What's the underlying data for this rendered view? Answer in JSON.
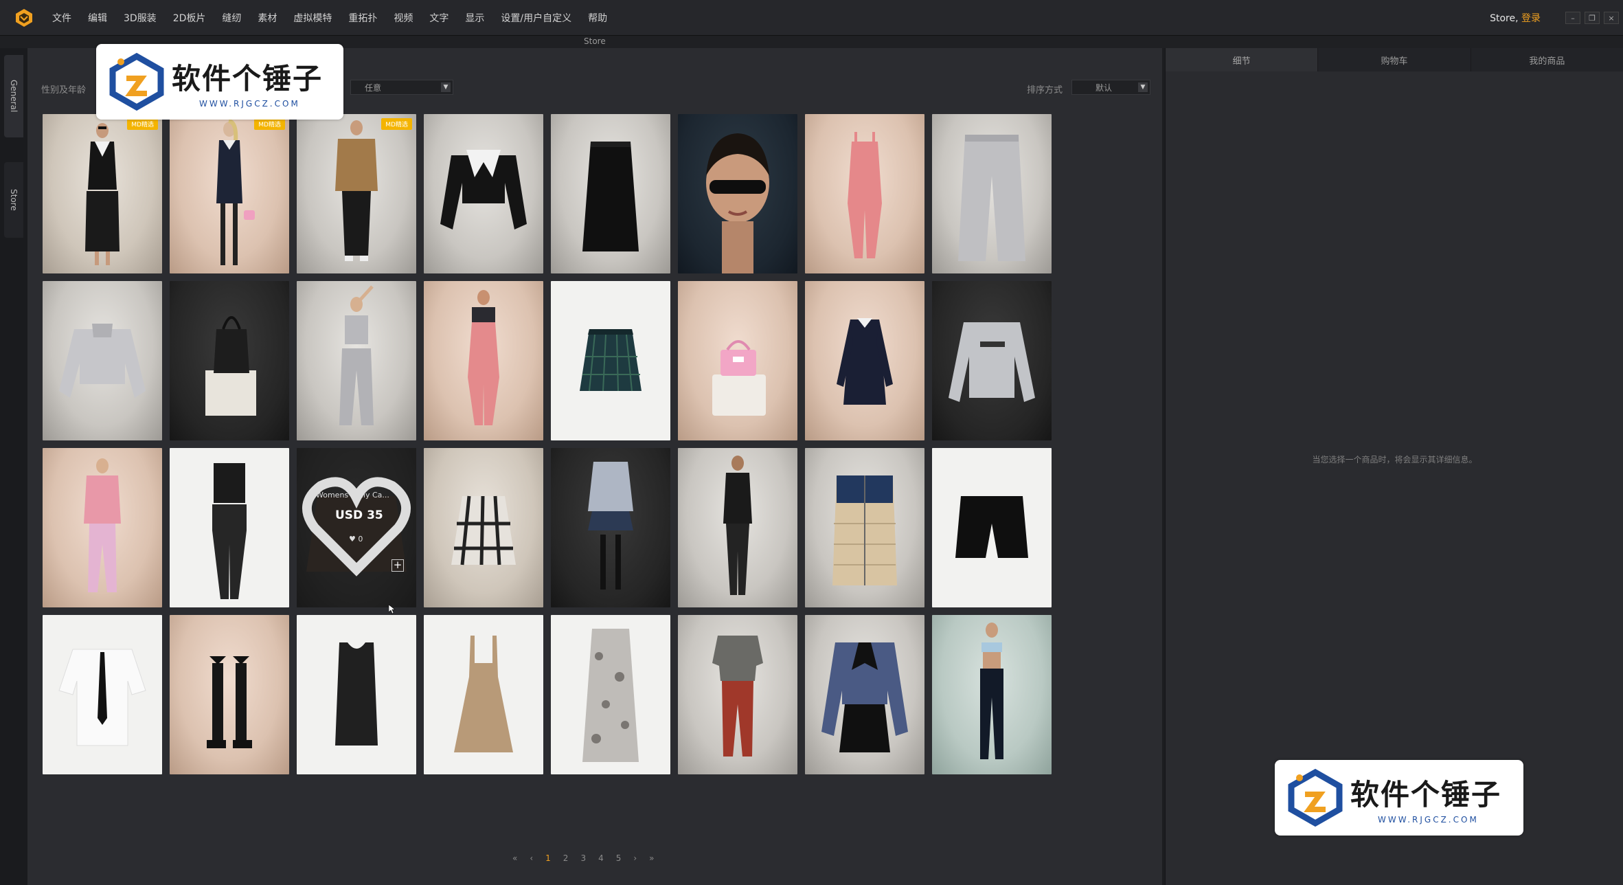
{
  "menubar": {
    "items": [
      "文件",
      "编辑",
      "3D服装",
      "2D板片",
      "缝纫",
      "素材",
      "虚拟模特",
      "重拓扑",
      "视频",
      "文字",
      "显示",
      "设置/用户自定义",
      "帮助"
    ],
    "store_user": "Store,",
    "login": "登录"
  },
  "store_strip": {
    "label": "Store"
  },
  "side_tabs": {
    "general": "General",
    "store": "Store"
  },
  "filters": {
    "gender_label": "性别及年龄",
    "gender_value": "任意",
    "sort_label": "排序方式",
    "sort_value": "默认"
  },
  "grid": {
    "badge_text": "MD精选",
    "items": [
      {
        "bg": "studio",
        "kind": "model-dark-outfit",
        "badge": true
      },
      {
        "bg": "pink",
        "kind": "model-navy-dress",
        "badge": true
      },
      {
        "bg": "grey",
        "kind": "model-brown-sweater",
        "badge": true
      },
      {
        "bg": "grey",
        "kind": "crop-jacket-black",
        "badge": false
      },
      {
        "bg": "grey",
        "kind": "skirt-black",
        "badge": false
      },
      {
        "bg": "navy",
        "kind": "avatar-head",
        "badge": false
      },
      {
        "bg": "pink",
        "kind": "pink-jumpsuit",
        "badge": false
      },
      {
        "bg": "grey",
        "kind": "grey-pants",
        "badge": false
      },
      {
        "bg": "grey",
        "kind": "grey-crop-sweatshirt",
        "badge": false
      },
      {
        "bg": "dark",
        "kind": "black-bag",
        "badge": false
      },
      {
        "bg": "grey",
        "kind": "model-grey-set",
        "badge": false
      },
      {
        "bg": "pink",
        "kind": "model-pink-overall",
        "badge": false
      },
      {
        "bg": "white",
        "kind": "plaid-skirt-green",
        "badge": false
      },
      {
        "bg": "pink",
        "kind": "pink-bag",
        "badge": false
      },
      {
        "bg": "pink",
        "kind": "navy-dress",
        "badge": false
      },
      {
        "bg": "dark",
        "kind": "grey-sweatshirt-logo",
        "badge": false
      },
      {
        "bg": "pink",
        "kind": "model-pink-sweater",
        "badge": false
      },
      {
        "bg": "white",
        "kind": "black-corset-pants",
        "badge": false
      },
      {
        "bg": "dark",
        "kind": "hover-cardigan",
        "badge": false
      },
      {
        "bg": "studio",
        "kind": "plaid-skirt-bw",
        "badge": false
      },
      {
        "bg": "dark",
        "kind": "uniform-set",
        "badge": false
      },
      {
        "bg": "grey",
        "kind": "model-black-leather",
        "badge": false
      },
      {
        "bg": "grey",
        "kind": "puffer-vest",
        "badge": false
      },
      {
        "bg": "white",
        "kind": "black-shorts",
        "badge": false
      },
      {
        "bg": "white",
        "kind": "white-shirt-tie",
        "badge": false
      },
      {
        "bg": "pink",
        "kind": "black-boots",
        "badge": false
      },
      {
        "bg": "white",
        "kind": "black-tank",
        "badge": false
      },
      {
        "bg": "white",
        "kind": "beige-pinafore",
        "badge": false
      },
      {
        "bg": "white",
        "kind": "floral-robe",
        "badge": false
      },
      {
        "bg": "grey",
        "kind": "grey-tee-red-pants",
        "badge": false
      },
      {
        "bg": "grey",
        "kind": "denim-jacket-set",
        "badge": false
      },
      {
        "bg": "teal",
        "kind": "model-bandeau",
        "badge": false
      }
    ]
  },
  "hover_card": {
    "name": "Womens Daily Ca...",
    "price": "USD 35",
    "likes": "♥ 0",
    "add": "+"
  },
  "pagination": {
    "first": "«",
    "prev": "‹",
    "pages": [
      "1",
      "2",
      "3",
      "4",
      "5"
    ],
    "active": "1",
    "next": "›",
    "last": "»"
  },
  "right_panel": {
    "tabs": [
      "细节",
      "购物车",
      "我的商品"
    ],
    "empty_text": "当您选择一个商品时，将会显示其详细信息。"
  },
  "watermark": {
    "title": "软件个锤子",
    "url": "WWW.RJGCZ.COM"
  },
  "colors": {
    "accent": "#f0a020",
    "badge": "#f4b400"
  }
}
